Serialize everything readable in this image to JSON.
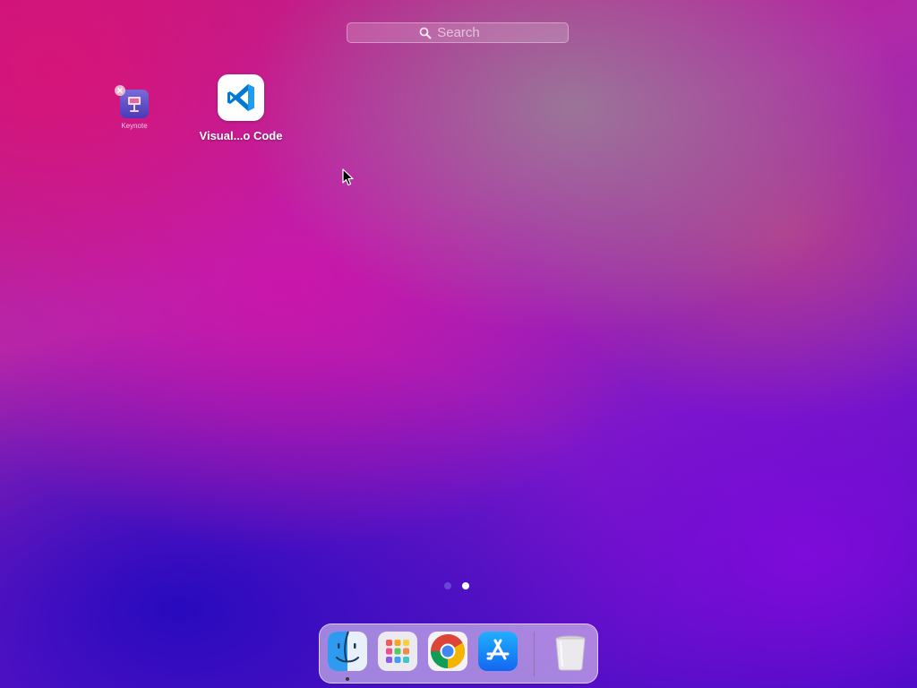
{
  "search": {
    "placeholder": "Search"
  },
  "apps": [
    {
      "name": "Keynote",
      "label": "Keynote",
      "icon": "keynote-icon",
      "deletable": true
    },
    {
      "name": "Visual Studio Code",
      "label": "Visual...o Code",
      "icon": "vscode-icon"
    }
  ],
  "pagination": {
    "total_pages": 2,
    "current_page": 2
  },
  "dock": {
    "items": [
      {
        "name": "Finder",
        "icon": "finder-icon",
        "running": true
      },
      {
        "name": "Launchpad",
        "icon": "launchpad-icon",
        "running": false
      },
      {
        "name": "Google Chrome",
        "icon": "chrome-icon",
        "running": false
      },
      {
        "name": "App Store",
        "icon": "app-store-icon",
        "running": false
      },
      {
        "name": "Trash",
        "icon": "trash-icon",
        "running": false
      }
    ]
  },
  "colors": {
    "vscode_blue": "#0078d4",
    "chrome_red": "#db4437",
    "chrome_yellow": "#f4b400",
    "chrome_green": "#0f9d58",
    "chrome_blue": "#4285f4",
    "app_store_blue": "#1a8cff"
  }
}
